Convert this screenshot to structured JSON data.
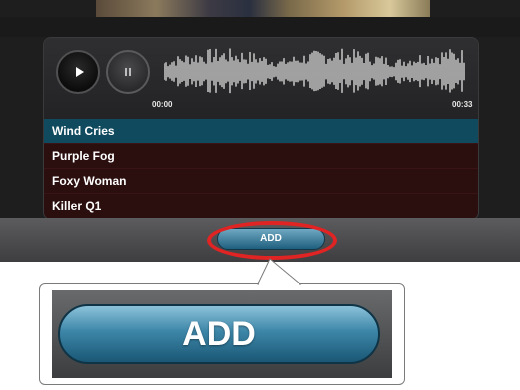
{
  "player": {
    "play_icon": "play-icon",
    "pause_icon": "pause-icon",
    "time_start": "00:00",
    "time_end": "00:33"
  },
  "tracks": [
    {
      "title": "Wind Cries",
      "selected": true
    },
    {
      "title": "Purple Fog",
      "selected": false
    },
    {
      "title": "Foxy Woman",
      "selected": false
    },
    {
      "title": "Killer Q1",
      "selected": false
    }
  ],
  "bottom_bar": {
    "add_label": "ADD"
  },
  "callout": {
    "add_label": "ADD"
  },
  "colors": {
    "selected_row": "#0f4a5e",
    "row": "#2b0f0f",
    "highlight_ring": "#e02323",
    "button_blue": "#3d86a8"
  }
}
